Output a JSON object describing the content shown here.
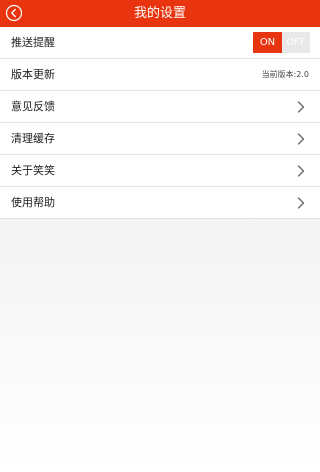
{
  "header": {
    "title": "我的设置",
    "back_icon": "back-circle-icon"
  },
  "settings": {
    "push": {
      "label": "推送提醒",
      "toggle_on": "ON",
      "toggle_off": "OFF",
      "enabled": true
    },
    "version": {
      "label": "版本更新",
      "current": "当前版本:2.0"
    },
    "feedback": {
      "label": "意见反馈"
    },
    "clear_cache": {
      "label": "清理缓存"
    },
    "about": {
      "label": "关于笑笑"
    },
    "help": {
      "label": "使用帮助"
    }
  },
  "colors": {
    "accent": "#e8340f",
    "toggle_off_bg": "#e8e8e8",
    "chevron": "#666666"
  }
}
